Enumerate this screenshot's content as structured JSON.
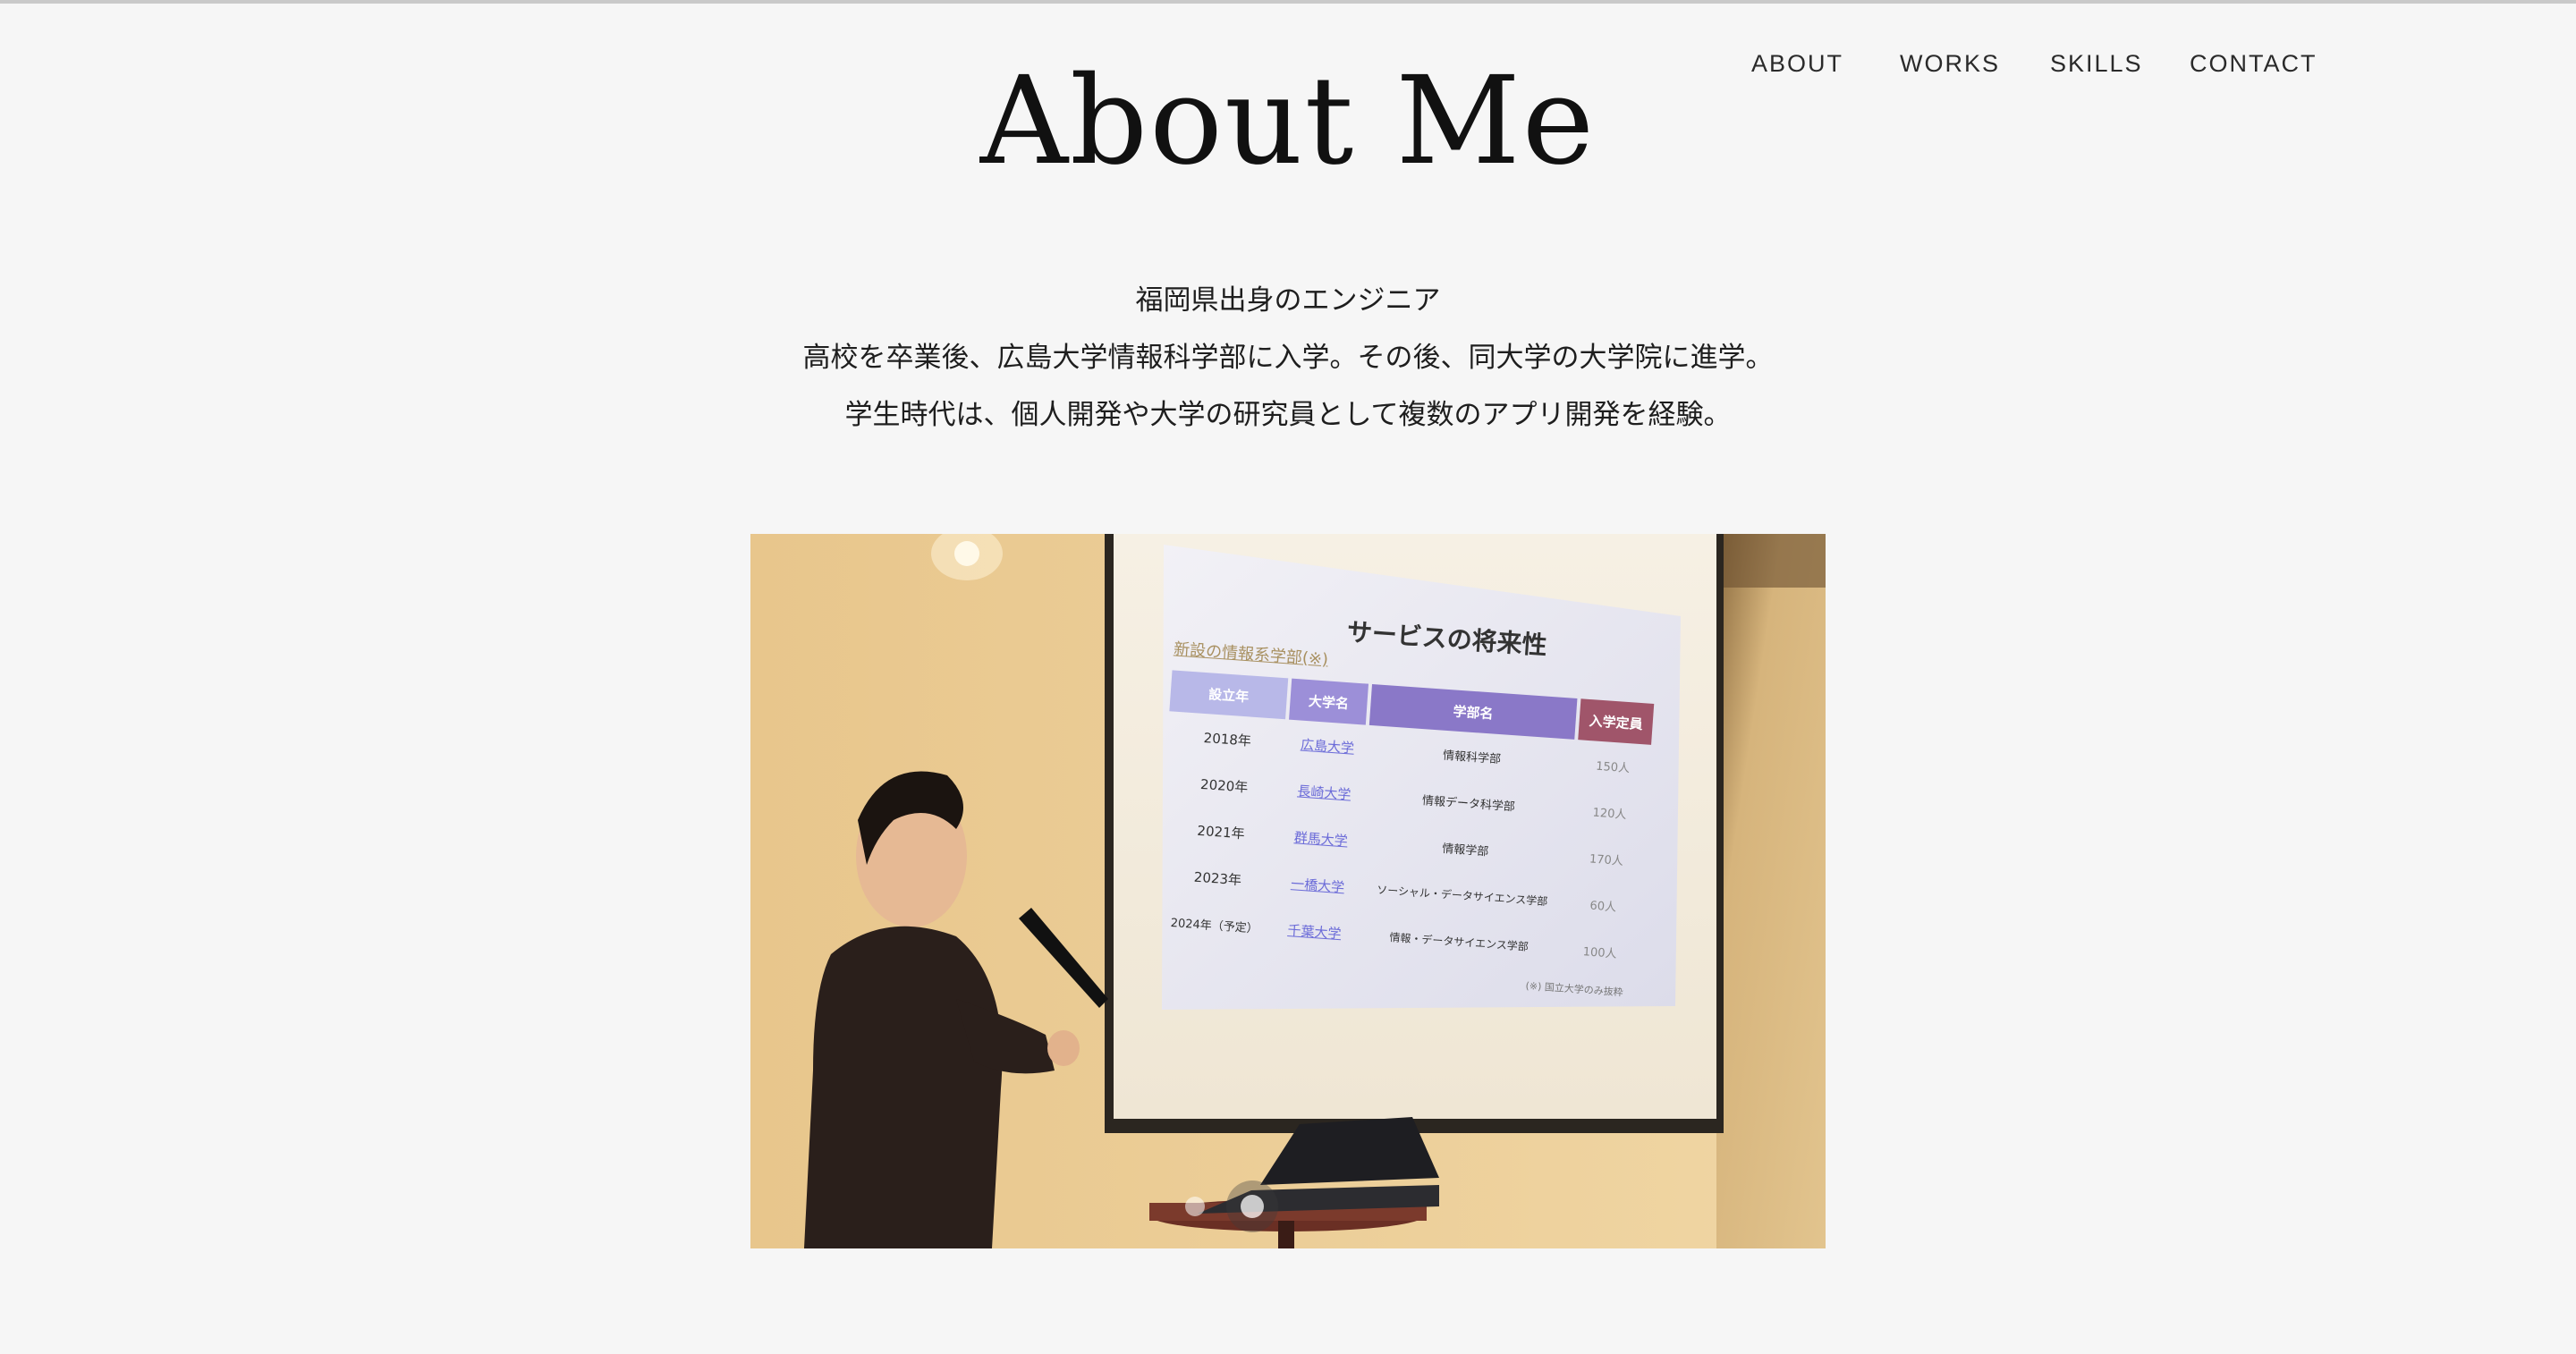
{
  "header": {
    "title": "About Me",
    "nav": {
      "about": "ABOUT",
      "works": "WORKS",
      "skills": "SKILLS",
      "contact": "CONTACT"
    }
  },
  "intro": {
    "lines": [
      "福岡県出身のエンジニア",
      "高校を卒業後、広島大学情報科学部に入学。その後、同大学の大学院に進学。",
      "学生時代は、個人開発や大学の研究員として複数のアプリ開発を経験。"
    ]
  },
  "slide": {
    "title": "サービスの将来性",
    "subtitle": "新設の情報系学部(※)",
    "headers": [
      "設立年",
      "大学名",
      "学部名",
      "入学定員"
    ],
    "rows": [
      [
        "2018年",
        "広島大学",
        "情報科学部",
        "150人"
      ],
      [
        "2020年",
        "長崎大学",
        "情報データ科学部",
        "120人"
      ],
      [
        "2021年",
        "群馬大学",
        "情報学部",
        "170人"
      ],
      [
        "2023年",
        "一橋大学",
        "ソーシャル・データサイエンス学部",
        "60人"
      ],
      [
        "2024年（予定）",
        "千葉大学",
        "情報・データサイエンス学部",
        "100人"
      ]
    ],
    "footnote": "(※) 国立大学のみ抜粋"
  },
  "carousel": {
    "slide_count": 2,
    "active_index": 1
  },
  "colors": {
    "background": "#f6f6f6",
    "text": "#1a1a1a"
  }
}
